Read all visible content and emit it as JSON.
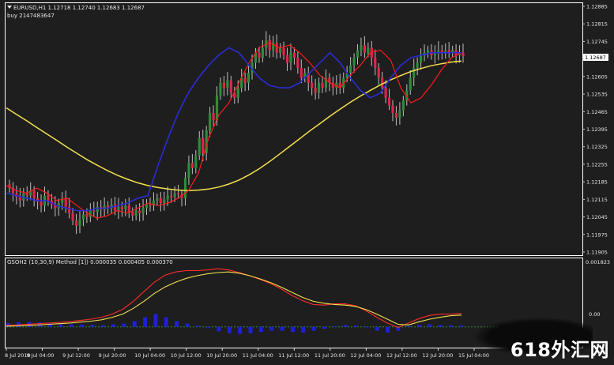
{
  "header": {
    "symbol_line": "EURUSD,H1  1.12718 1.12740 1.12683 1.12687",
    "order_line": "buy 2147483647"
  },
  "indicator": {
    "title": "GSOH2 (10,30,9) Method [1]) 0.000035 0.000405 0.000370",
    "top_label": "0.001823",
    "zero_label": "0.00"
  },
  "watermark": "618外汇网",
  "colors": {
    "background": "#1e1e1e",
    "panel_border": "#ffffff",
    "bull_candle": "#2e8b3a",
    "bear_candle": "#e0244a",
    "wick": "#bfbfbf",
    "ma_slow": "#f4e04d",
    "channel_red": "#ff1a1a",
    "channel_blue": "#2b2bd9",
    "osc_signal": "#f4e04d",
    "osc_main": "#ff2a2a",
    "histogram": "#1f1fd6",
    "zero_line": "#2e8b3a"
  },
  "chart_data": {
    "type": "candlestick",
    "symbol": "EURUSD",
    "timeframe": "H1",
    "price_axis": {
      "ticks": [
        "1.12885",
        "1.12815",
        "1.12745",
        "1.12675",
        "1.12605",
        "1.12535",
        "1.12465",
        "1.12395",
        "1.12325",
        "1.12255",
        "1.12185",
        "1.12115",
        "1.12045",
        "1.11975",
        "1.11905"
      ],
      "current_price": "1.12687",
      "ylim": [
        1.11905,
        1.12885
      ]
    },
    "time_axis": {
      "ticks": [
        "8 Jul 2019",
        "9 Jul 04:00",
        "9 Jul 12:00",
        "9 Jul 20:00",
        "10 Jul 04:00",
        "10 Jul 12:00",
        "10 Jul 20:00",
        "11 Jul 04:00",
        "11 Jul 12:00",
        "11 Jul 20:00",
        "12 Jul 04:00",
        "12 Jul 12:00",
        "12 Jul 20:00",
        "15 Jul 04:00"
      ]
    },
    "closes": [
      1.1216,
      1.1214,
      1.12125,
      1.1211,
      1.1214,
      1.1213,
      1.1215,
      1.1212,
      1.12105,
      1.1209,
      1.1213,
      1.1211,
      1.12095,
      1.1208,
      1.121,
      1.1212,
      1.12085,
      1.1206,
      1.1203,
      1.1201,
      1.12035,
      1.12055,
      1.12045,
      1.1207,
      1.12065,
      1.12085,
      1.12075,
      1.1209,
      1.1208,
      1.12095,
      1.1207,
      1.12085,
      1.12075,
      1.1209,
      1.12065,
      1.1205,
      1.1207,
      1.1206,
      1.1208,
      1.12095,
      1.1209,
      1.1211,
      1.1212,
      1.121,
      1.12115,
      1.1213,
      1.12125,
      1.1214,
      1.12135,
      1.1212,
      1.122,
      1.1226,
      1.1224,
      1.1229,
      1.1236,
      1.123,
      1.1239,
      1.1246,
      1.1243,
      1.1253,
      1.1258,
      1.1256,
      1.1259,
      1.1254,
      1.1252,
      1.1256,
      1.126,
      1.1258,
      1.1262,
      1.1266,
      1.127,
      1.1268,
      1.1272,
      1.1275,
      1.1271,
      1.1274,
      1.127,
      1.1272,
      1.1269,
      1.1266,
      1.127,
      1.1268,
      1.1264,
      1.126,
      1.1262,
      1.1258,
      1.1256,
      1.1254,
      1.1258,
      1.1256,
      1.126,
      1.1258,
      1.1256,
      1.1258,
      1.1256,
      1.126,
      1.1262,
      1.1265,
      1.1268,
      1.1271,
      1.1273,
      1.127,
      1.1272,
      1.1268,
      1.1264,
      1.126,
      1.1256,
      1.1252,
      1.1249,
      1.1246,
      1.1244,
      1.1247,
      1.1251,
      1.1255,
      1.126,
      1.1264,
      1.1266,
      1.1269,
      1.127,
      1.1271,
      1.1269,
      1.127,
      1.1271,
      1.127,
      1.1271,
      1.127,
      1.1271,
      1.1269,
      1.127,
      1.12687
    ],
    "ma_slow": [
      1.1248,
      1.12454,
      1.12429,
      1.12402,
      1.12376,
      1.1235,
      1.12323,
      1.12298,
      1.12273,
      1.12251,
      1.1223,
      1.12211,
      1.12195,
      1.12181,
      1.1217,
      1.12162,
      1.12156,
      1.12152,
      1.1215,
      1.12152,
      1.12156,
      1.12164,
      1.12176,
      1.12192,
      1.12213,
      1.12237,
      1.12265,
      1.12295,
      1.12326,
      1.12357,
      1.12388,
      1.12417,
      1.12447,
      1.12475,
      1.12502,
      1.12527,
      1.1255,
      1.12572,
      1.12592,
      1.12609,
      1.12625,
      1.12637,
      1.12648,
      1.12656,
      1.12663,
      1.12667
    ],
    "channel_red": [
      1.1217,
      1.1215,
      1.1214,
      1.1216,
      1.1214,
      1.1211,
      1.1212,
      1.1209,
      1.1206,
      1.1204,
      1.1205,
      1.1207,
      1.1206,
      1.1208,
      1.121,
      1.1209,
      1.121,
      1.1212,
      1.1215,
      1.1222,
      1.1236,
      1.1245,
      1.125,
      1.1258,
      1.1266,
      1.1272,
      1.1274,
      1.1272,
      1.1273,
      1.127,
      1.1266,
      1.1261,
      1.1258,
      1.1256,
      1.1261,
      1.1265,
      1.127,
      1.1271,
      1.1267,
      1.1256,
      1.125,
      1.1252,
      1.1257,
      1.1263,
      1.1268,
      1.127
    ],
    "channel_blue": [
      1.1214,
      1.1213,
      1.1212,
      1.1211,
      1.1211,
      1.1209,
      1.1208,
      1.1207,
      1.1207,
      1.1208,
      1.1208,
      1.1209,
      1.121,
      1.1212,
      1.1213,
      1.1225,
      1.1236,
      1.1246,
      1.1254,
      1.126,
      1.1265,
      1.1269,
      1.1272,
      1.127,
      1.1265,
      1.126,
      1.1257,
      1.1256,
      1.1256,
      1.1258,
      1.1262,
      1.1266,
      1.127,
      1.1266,
      1.126,
      1.1255,
      1.1252,
      1.1254,
      1.126,
      1.1265,
      1.1268,
      1.1269,
      1.127,
      1.127,
      1.127,
      1.127
    ],
    "oscillator": {
      "main": [
        5e-05,
        6e-05,
        8e-05,
        0.0001,
        0.00012,
        0.00014,
        0.00017,
        0.0002,
        0.00024,
        0.0003,
        0.0004,
        0.00055,
        0.0008,
        0.0011,
        0.0014,
        0.00162,
        0.00172,
        0.00176,
        0.00176,
        0.00178,
        0.00182,
        0.00178,
        0.0017,
        0.0016,
        0.00148,
        0.00135,
        0.00118,
        0.00098,
        0.00082,
        0.0007,
        0.00068,
        0.00072,
        0.00072,
        0.00066,
        0.0005,
        0.0003,
        0.00012,
        -2e-05,
        0.00012,
        0.00026,
        0.00036,
        0.0004,
        0.0004,
        0.00042
      ],
      "signal": [
        2e-05,
        3e-05,
        5e-05,
        6e-05,
        8e-05,
        0.0001,
        0.00012,
        0.00015,
        0.00018,
        0.00022,
        0.0003,
        0.0004,
        0.00058,
        0.0008,
        0.00105,
        0.00125,
        0.0014,
        0.00152,
        0.0016,
        0.00166,
        0.0017,
        0.00172,
        0.00168,
        0.0016,
        0.0015,
        0.00138,
        0.00124,
        0.00108,
        0.00092,
        0.0008,
        0.00074,
        0.0007,
        0.00068,
        0.00064,
        0.00054,
        0.0004,
        0.00024,
        8e-05,
        6e-05,
        0.00016,
        0.00024,
        0.0003,
        0.00035,
        0.00037
      ],
      "histogram": [
        0.00012,
        0.00014,
        0.00015,
        0.00014,
        0.0001,
        8e-05,
        8e-05,
        7e-05,
        6e-05,
        5e-05,
        8e-05,
        0.0001,
        0.00018,
        0.0003,
        0.0004,
        0.0003,
        0.00018,
        0.0001,
        4e-05,
        -4e-05,
        -0.00014,
        -0.0002,
        -0.00022,
        -0.0002,
        -0.00016,
        -0.00012,
        -0.00012,
        -0.00016,
        -0.00018,
        -0.00012,
        -6e-05,
        2e-05,
        6e-05,
        4e-05,
        -2e-05,
        -0.00012,
        -0.00018,
        -0.00012,
        3e-05,
        6e-05,
        8e-05,
        6e-05,
        5e-05,
        4e-05
      ],
      "ylim": [
        -0.0006,
        0.001823
      ]
    }
  }
}
